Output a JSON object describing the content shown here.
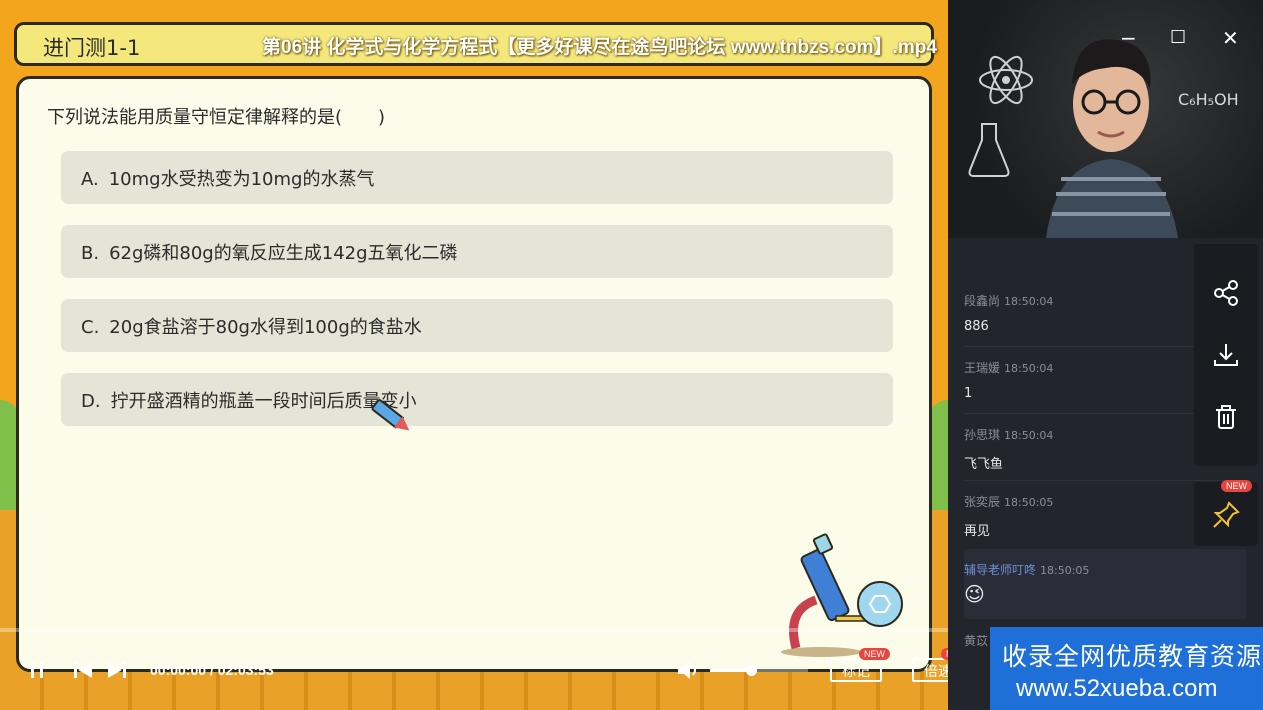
{
  "video": {
    "file_title": "第06讲 化学式与化学方程式【更多好课尽在途鸟吧论坛 www.tnbzs.com】.mp4",
    "quiz_label": "进门测1-1",
    "question": "下列说法能用质量守恒定律解释的是(　　)",
    "options": [
      {
        "letter": "A.",
        "text": "10mg水受热变为10mg的水蒸气"
      },
      {
        "letter": "B.",
        "text": "62g磷和80g的氧反应生成142g五氧化二磷"
      },
      {
        "letter": "C.",
        "text": "20g食盐溶于80g水得到100g的食盐水"
      },
      {
        "letter": "D.",
        "text": "拧开盛酒精的瓶盖一段时间后质量变小"
      }
    ]
  },
  "player": {
    "time": "00:00:00 / 02:03:53",
    "progress": 0.0,
    "volume": 0.42,
    "mark_label": "标记",
    "speed_label": "倍速",
    "new_badge": "NEW",
    "icons": [
      "pause-icon",
      "prev-icon",
      "next-icon",
      "volume-icon"
    ]
  },
  "window": {
    "minimize": "−",
    "maximize": "☐",
    "close": "✕"
  },
  "camera": {
    "board_text": "C₆H₅OH"
  },
  "chat": {
    "messages": [
      {
        "name": "段鑫尚",
        "time": "18:50:04",
        "text": "886"
      },
      {
        "name": "王瑞媛",
        "time": "18:50:04",
        "text": "1"
      },
      {
        "name": "孙思琪",
        "time": "18:50:04",
        "text": "飞飞鱼"
      },
      {
        "name": "张奕辰",
        "time": "18:50:05",
        "text": "再见"
      },
      {
        "name": "辅导老师叮咚",
        "time": "18:50:05",
        "text": "😉"
      }
    ],
    "partial_name": "黄苡"
  },
  "side_tools": {
    "items": [
      "share-icon",
      "download-icon",
      "delete-icon",
      "pin-icon"
    ],
    "new_badge": "NEW"
  },
  "ad": {
    "line1": "收录全网优质教育资源",
    "line2": "www.52xueba.com"
  },
  "colors": {
    "accent_blue": "#1f6fd8",
    "title_yellow": "#f4e87d",
    "board": "#fbfce9",
    "badge_red": "#e8453c"
  }
}
